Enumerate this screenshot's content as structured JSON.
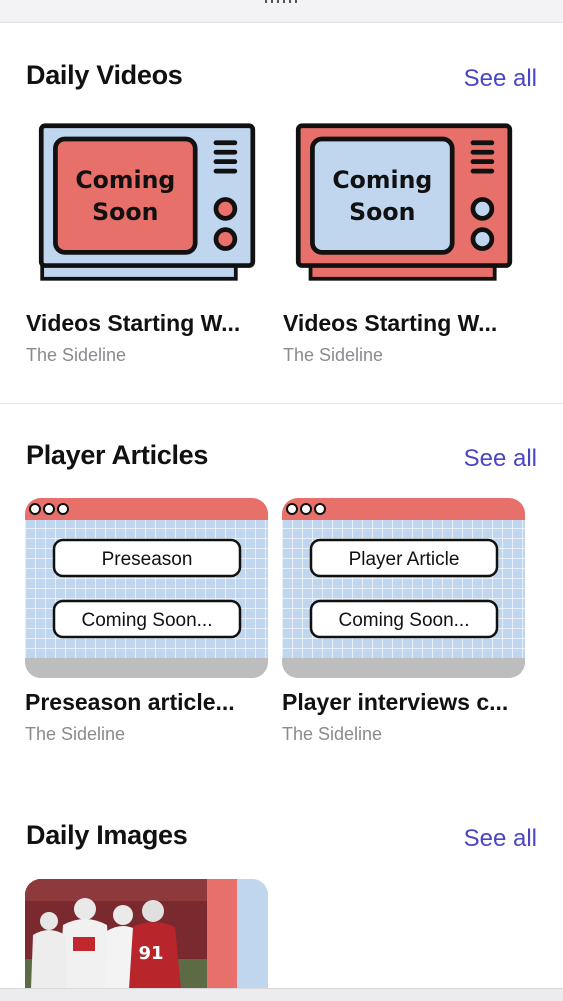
{
  "sections": [
    {
      "title": "Daily Videos",
      "see_all": "See all",
      "cards": [
        {
          "thumb_text_line1": "Coming",
          "thumb_text_line2": "Soon",
          "title": "Videos Starting W...",
          "source": "The Sideline"
        },
        {
          "thumb_text_line1": "Coming",
          "thumb_text_line2": "Soon",
          "title": "Videos Starting W...",
          "source": "The Sideline"
        }
      ]
    },
    {
      "title": "Player Articles",
      "see_all": "See all",
      "cards": [
        {
          "thumb_label_top": "Preseason",
          "thumb_label_bottom": "Coming Soon...",
          "title": "Preseason article...",
          "source": "The Sideline"
        },
        {
          "thumb_label_top": "Player Article",
          "thumb_label_bottom": "Coming Soon...",
          "title": "Player interviews c...",
          "source": "The Sideline"
        }
      ]
    },
    {
      "title": "Daily Images",
      "see_all": "See all",
      "cards": [
        {
          "jersey_number": "91"
        }
      ]
    }
  ],
  "colors": {
    "accent_link": "#4a45c8",
    "tv_red": "#e8706a",
    "tv_blue": "#bfd6ee",
    "secondary_text": "#8a8a8f"
  }
}
